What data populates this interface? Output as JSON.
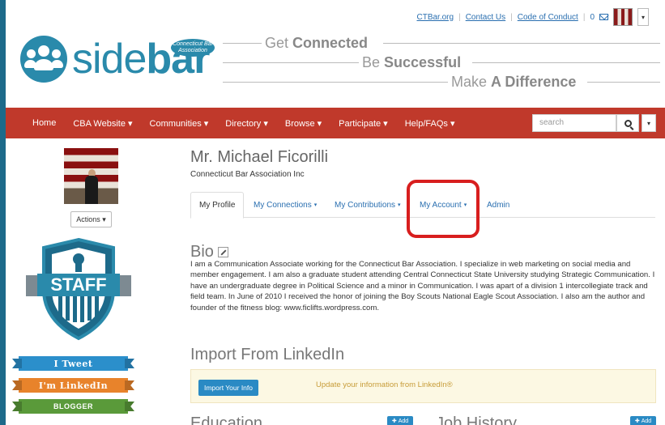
{
  "header": {
    "top_links": [
      "CTBar.org",
      "Contact Us",
      "Code of Conduct"
    ],
    "message_count": "0",
    "logo_text_light": "side",
    "logo_text_bold": "bar",
    "logo_badge": "Connecticut Bar Association",
    "tagline_1_light": "Get ",
    "tagline_1_bold": "Connected",
    "tagline_2_light": "Be ",
    "tagline_2_bold": "Successful",
    "tagline_3_light": "Make ",
    "tagline_3_bold": "A Difference"
  },
  "nav": {
    "items": [
      "Home",
      "CBA Website ▾",
      "Communities ▾",
      "Directory ▾",
      "Browse ▾",
      "Participate ▾",
      "Help/FAQs ▾"
    ],
    "search_placeholder": "search"
  },
  "sidebar": {
    "actions_label": "Actions ▾",
    "badge_text": "STAFF",
    "ribbons": [
      "I Tweet",
      "I'm LinkedIn",
      "BLOGGER"
    ]
  },
  "profile": {
    "name": "Mr. Michael Ficorilli",
    "organization": "Connecticut Bar Association Inc",
    "tabs": [
      "My Profile",
      "My Connections",
      "My Contributions",
      "My Account",
      "Admin"
    ],
    "bio_title": "Bio",
    "bio_text": "I am a Communication Associate working for the Connecticut Bar Association. I specialize in web marketing on social media and member engagement. I am also a graduate student attending Central Connecticut State University studying Strategic Communication. I have an undergraduate degree in Political Science and a minor in Communication. I was apart of a division 1 intercollegiate track and field team. In June of 2010 I received the honor of joining the Boy Scouts National Eagle Scout Association. I also am the author and founder of the fitness blog: www.ficlifts.wordpress.com.",
    "import_title": "Import From LinkedIn",
    "import_button": "Import Your Info",
    "import_note": "Update your information from LinkedIn®",
    "education_title": "Education",
    "job_history_title": "Job History",
    "add_label": "Add"
  },
  "colors": {
    "nav_bg": "#c0392b",
    "brand_blue": "#2a8aab",
    "highlight_red": "#d81e1e"
  }
}
